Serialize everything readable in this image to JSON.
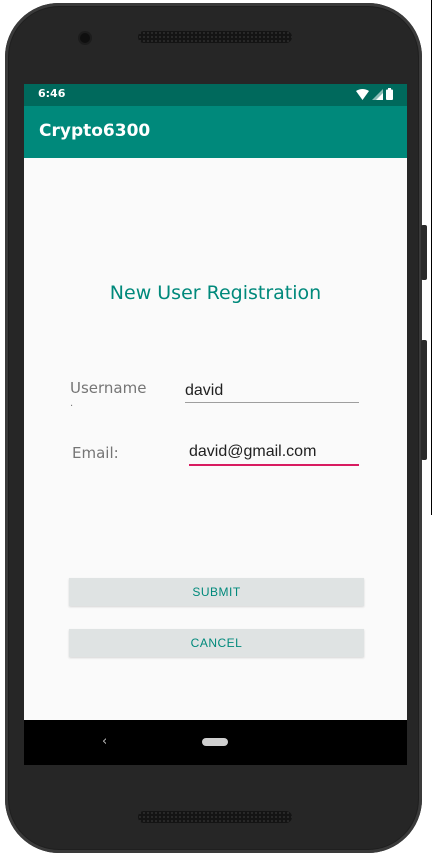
{
  "status_bar": {
    "time": "6:46"
  },
  "app_bar": {
    "title": "Crypto6300"
  },
  "form": {
    "title": "New User Registration",
    "username_label": "Username",
    "username_label_overflow": ".",
    "username_value": "david",
    "email_label": "Email:",
    "email_value": "david@gmail.com"
  },
  "buttons": {
    "submit": "SUBMIT",
    "cancel": "CANCEL"
  },
  "nav": {
    "back_icon": "‹"
  },
  "colors": {
    "primary": "#00897b",
    "primary_dark": "#00695c",
    "accent": "#d81b60"
  }
}
